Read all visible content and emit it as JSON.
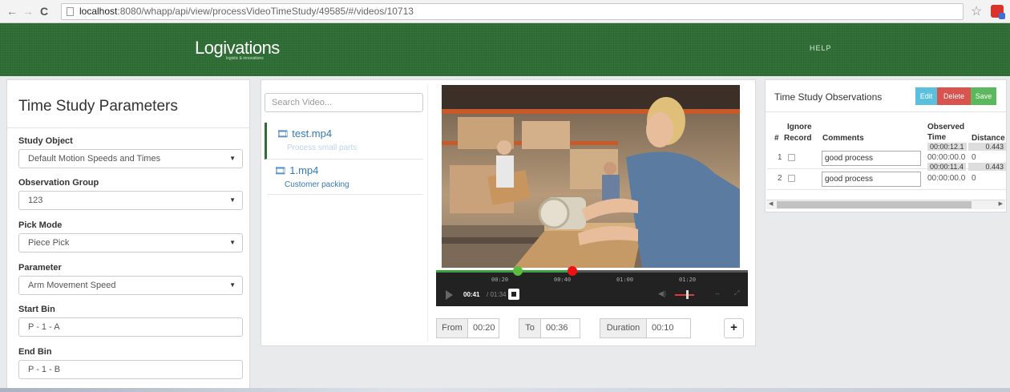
{
  "browser": {
    "back": "←",
    "forward": "→",
    "reload": "C",
    "url_host": "localhost",
    "url_rest": ":8080/whapp/api/view/processVideoTimeStudy/49585/#/videos/10713",
    "star": "☆"
  },
  "header": {
    "logo": "Logivations",
    "logo_sub": "logistic & innovations",
    "help": "HELP",
    "colors": {
      "header_bg": "#2e6d34"
    }
  },
  "params": {
    "title": "Time Study Parameters",
    "fields": [
      {
        "label": "Study Object",
        "value": "Default Motion Speeds and Times"
      },
      {
        "label": "Observation Group",
        "value": "123"
      },
      {
        "label": "Pick Mode",
        "value": "Piece Pick"
      },
      {
        "label": "Parameter",
        "value": "Arm Movement Speed"
      },
      {
        "label": "Start Bin",
        "value": "P - 1 - A"
      },
      {
        "label": "End Bin",
        "value": "P - 1 - B"
      }
    ],
    "caret": "▼"
  },
  "videos": {
    "search_placeholder": "Search Video...",
    "film_icon": "🎞",
    "items": [
      {
        "name": "test.mp4",
        "desc": "Process small parts"
      },
      {
        "name": "1.mp4",
        "desc": "Customer packing"
      }
    ]
  },
  "player": {
    "ticks": [
      "00:20",
      "00:40",
      "01:00",
      "01:20"
    ],
    "current": "00:41",
    "total": "/ 01:34",
    "played_fraction": 0.436
  },
  "range": {
    "from_label": "From",
    "from_value": "00:20",
    "to_label": "To",
    "to_value": "00:36",
    "duration_label": "Duration",
    "duration_value": "00:10",
    "plus": "+"
  },
  "observations": {
    "title": "Time Study Observations",
    "edit": "Edit",
    "delete": "Delete",
    "save": "Save",
    "headers": {
      "num": "#",
      "ignore1": "Ignore",
      "ignore2": "Record",
      "comments": "Comments",
      "obs1": "Observed",
      "obs2": "Time",
      "distance": "Distance"
    },
    "rows": [
      {
        "num": "1",
        "comment": "good process",
        "time_pill": "00:00:12.1",
        "dist_pill": "0.443",
        "time": "00:00:00.0",
        "dist": "0"
      },
      {
        "num": "2",
        "comment": "good process",
        "time_pill": "00:00:11.4",
        "dist_pill": "0.443",
        "time": "00:00:00.0",
        "dist": "0"
      }
    ]
  }
}
